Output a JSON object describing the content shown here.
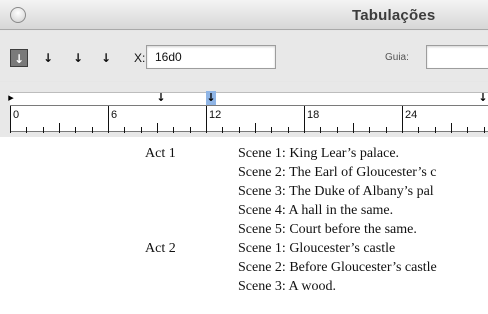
{
  "window": {
    "title": "Tabulações"
  },
  "toolbar": {
    "tab_buttons": [
      {
        "glyph": "↓",
        "name": "left-justified-tab-icon",
        "active": true
      },
      {
        "glyph": "↓",
        "name": "center-justified-tab-icon",
        "active": false
      },
      {
        "glyph": "↓",
        "name": "right-justified-tab-icon",
        "active": false
      },
      {
        "glyph": "↓",
        "name": "align-to-decimal-tab-icon",
        "active": false
      }
    ],
    "x_label": "X:",
    "x_value": "16d0",
    "guide_label": "Guia:",
    "guide_value": ""
  },
  "ruler": {
    "labels": [
      "0",
      "6",
      "12",
      "18",
      "24"
    ]
  },
  "document": {
    "rows": [
      {
        "act": "Act 1",
        "scene": "Scene 1: King Lear’s palace."
      },
      {
        "act": "",
        "scene": "Scene 2: The Earl of Gloucester’s c"
      },
      {
        "act": "",
        "scene": "Scene 3: The Duke of Albany’s pal"
      },
      {
        "act": "",
        "scene": "Scene 4: A hall in the same."
      },
      {
        "act": "",
        "scene": "Scene 5: Court before the same."
      },
      {
        "act": "Act 2",
        "scene": "Scene 1: Gloucester’s castle"
      },
      {
        "act": "",
        "scene": "Scene 2: Before Gloucester’s castle"
      },
      {
        "act": "",
        "scene": "Scene 3: A wood."
      }
    ]
  }
}
